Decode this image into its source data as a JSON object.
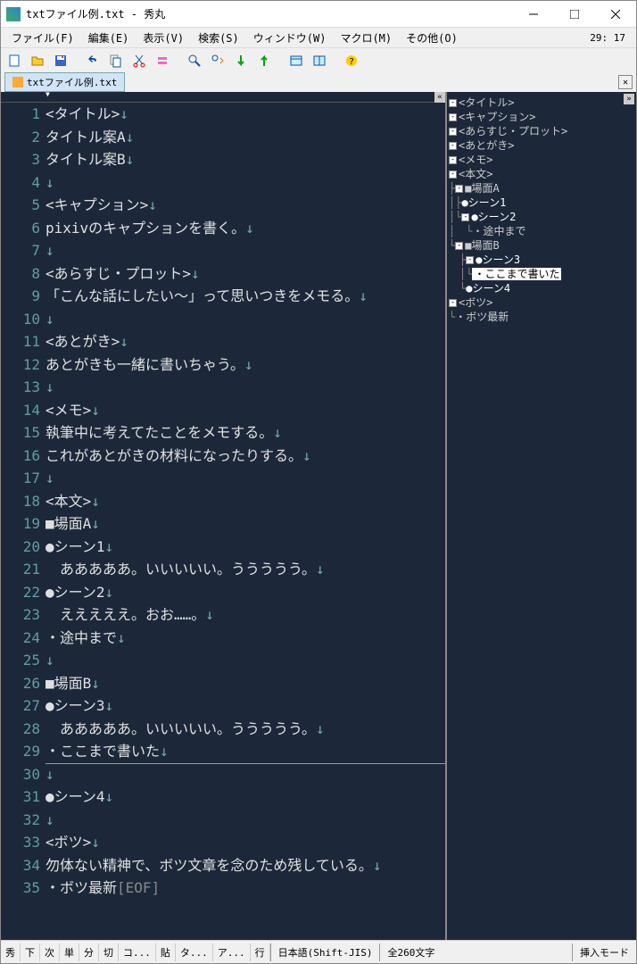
{
  "title": "txtファイル例.txt - 秀丸",
  "cursor_pos": "29: 17",
  "menu": {
    "file": "ファイル(F)",
    "edit": "編集(E)",
    "view": "表示(V)",
    "search": "検索(S)",
    "window": "ウィンドウ(W)",
    "macro": "マクロ(M)",
    "other": "その他(O)"
  },
  "tab": {
    "name": "txtファイル例.txt"
  },
  "lines": [
    {
      "n": 1,
      "t": "<タイトル>"
    },
    {
      "n": 2,
      "t": "タイトル案A"
    },
    {
      "n": 3,
      "t": "タイトル案B"
    },
    {
      "n": 4,
      "t": ""
    },
    {
      "n": 5,
      "t": "<キャプション>"
    },
    {
      "n": 6,
      "t": "pixivのキャプションを書く。"
    },
    {
      "n": 7,
      "t": ""
    },
    {
      "n": 8,
      "t": "<あらすじ・プロット>"
    },
    {
      "n": 9,
      "t": "「こんな話にしたい～」って思いつきをメモる。"
    },
    {
      "n": 10,
      "t": ""
    },
    {
      "n": 11,
      "t": "<あとがき>"
    },
    {
      "n": 12,
      "t": "あとがきも一緒に書いちゃう。"
    },
    {
      "n": 13,
      "t": ""
    },
    {
      "n": 14,
      "t": "<メモ>"
    },
    {
      "n": 15,
      "t": "執筆中に考えてたことをメモする。"
    },
    {
      "n": 16,
      "t": "これがあとがきの材料になったりする。"
    },
    {
      "n": 17,
      "t": ""
    },
    {
      "n": 18,
      "t": "<本文>"
    },
    {
      "n": 19,
      "t": "■場面A"
    },
    {
      "n": 20,
      "t": "●シーン1"
    },
    {
      "n": 21,
      "t": "　あああああ。いいいいい。ううううう。"
    },
    {
      "n": 22,
      "t": "●シーン2"
    },
    {
      "n": 23,
      "t": "　えええええ。おお……。"
    },
    {
      "n": 24,
      "t": "・途中まで"
    },
    {
      "n": 25,
      "t": ""
    },
    {
      "n": 26,
      "t": "■場面B"
    },
    {
      "n": 27,
      "t": "●シーン3"
    },
    {
      "n": 28,
      "t": "　あああああ。いいいいい。ううううう。"
    },
    {
      "n": 29,
      "t": "・ここまで書いた"
    },
    {
      "n": 30,
      "t": ""
    },
    {
      "n": 31,
      "t": "●シーン4"
    },
    {
      "n": 32,
      "t": ""
    },
    {
      "n": 33,
      "t": "<ボツ>"
    },
    {
      "n": 34,
      "t": "勿体ない精神で、ボツ文章を念のため残している。"
    },
    {
      "n": 35,
      "t": "・ボツ最新",
      "eof": true
    }
  ],
  "outline": [
    {
      "lvl": 0,
      "exp": "-",
      "txt": "<タイトル>"
    },
    {
      "lvl": 0,
      "exp": "-",
      "txt": "<キャプション>"
    },
    {
      "lvl": 0,
      "exp": "-",
      "txt": "<あらすじ・プロット>"
    },
    {
      "lvl": 0,
      "exp": "-",
      "txt": "<あとがき>"
    },
    {
      "lvl": 0,
      "exp": "-",
      "txt": "<メモ>"
    },
    {
      "lvl": 0,
      "exp": "-",
      "txt": "<本文>"
    },
    {
      "lvl": 1,
      "exp": "-",
      "txt": "■場面A",
      "pre": "├"
    },
    {
      "lvl": 2,
      "exp": "",
      "txt": "●シーン1",
      "pre": "│├",
      "bul": true
    },
    {
      "lvl": 2,
      "exp": "-",
      "txt": "●シーン2",
      "pre": "│└",
      "bul": true
    },
    {
      "lvl": 3,
      "exp": "",
      "txt": "・途中まで",
      "pre": "│　└"
    },
    {
      "lvl": 1,
      "exp": "-",
      "txt": "■場面B",
      "pre": "└"
    },
    {
      "lvl": 2,
      "exp": "-",
      "txt": "●シーン3",
      "pre": "　├",
      "bul": true
    },
    {
      "lvl": 3,
      "exp": "",
      "txt": "・ここまで書いた",
      "pre": "　│└",
      "sel": true
    },
    {
      "lvl": 2,
      "exp": "",
      "txt": "●シーン4",
      "pre": "　└",
      "bul": true
    },
    {
      "lvl": 0,
      "exp": "-",
      "txt": "<ボツ>"
    },
    {
      "lvl": 1,
      "exp": "",
      "txt": "・ボツ最新",
      "pre": "└"
    }
  ],
  "status": {
    "buttons": [
      "秀",
      "下",
      "次",
      "単",
      "分",
      "切",
      "コ...",
      "貼",
      "タ...",
      "ア...",
      "行"
    ],
    "encoding": "日本語(Shift-JIS)",
    "chars": "全260文字",
    "mode": "挿入モード"
  }
}
